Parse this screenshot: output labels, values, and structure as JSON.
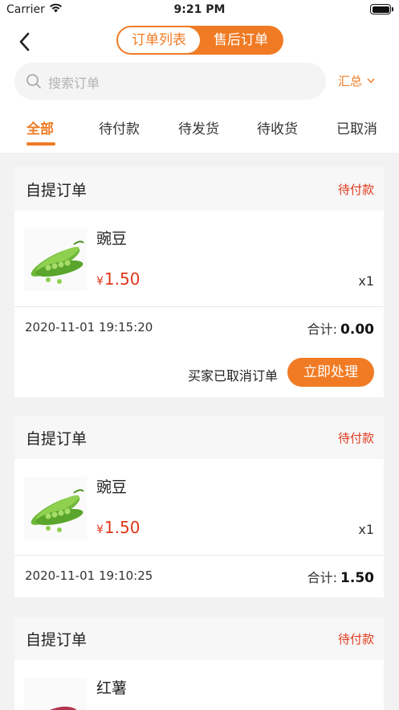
{
  "status_bar": {
    "carrier": "Carrier",
    "time": "9:21 PM"
  },
  "nav": {
    "segments": [
      "订单列表",
      "售后订单"
    ],
    "active_segment": 0
  },
  "search": {
    "placeholder": "搜索订单"
  },
  "summary_label": "汇总",
  "tabs": [
    "全部",
    "待付款",
    "待发货",
    "待收货",
    "已取消"
  ],
  "active_tab": 0,
  "orders": [
    {
      "type": "自提订单",
      "status": "待付款",
      "item": {
        "name": "豌豆",
        "currency": "¥",
        "price": "1.50",
        "qty": "x1",
        "image": "peas"
      },
      "datetime": "2020-11-01 19:15:20",
      "total_label": "合计:",
      "total": "0.00",
      "note": "买家已取消订单",
      "action": "立即处理"
    },
    {
      "type": "自提订单",
      "status": "待付款",
      "item": {
        "name": "豌豆",
        "currency": "¥",
        "price": "1.50",
        "qty": "x1",
        "image": "peas"
      },
      "datetime": "2020-11-01 19:10:25",
      "total_label": "合计:",
      "total": "1.50"
    },
    {
      "type": "自提订单",
      "status": "待付款",
      "item": {
        "name": "红薯",
        "image": "sweet-potato"
      }
    }
  ],
  "colors": {
    "accent": "#f07b24",
    "price_red": "#e0381c",
    "background": "#f2f2f2"
  }
}
